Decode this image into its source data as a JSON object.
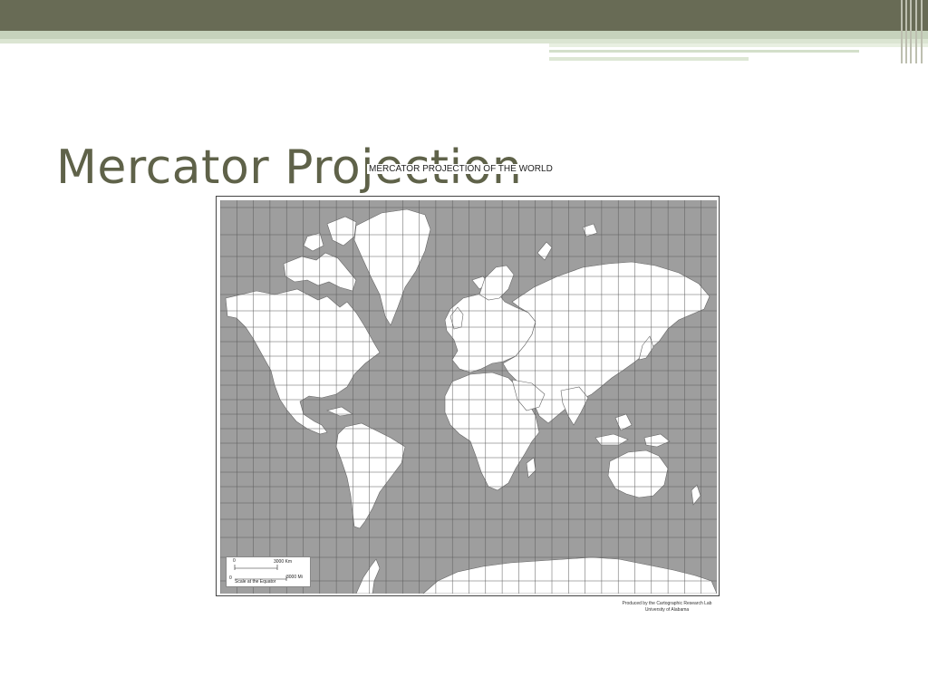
{
  "slide": {
    "title": "Mercator Projection"
  },
  "map": {
    "heading": "MERCATOR PROJECTION OF THE WORLD",
    "scale": {
      "km_label": "3000 Km",
      "mi_label": "3000 Mi",
      "zero_top": "0",
      "zero_bottom": "0",
      "caption": "Scale at the Equator"
    },
    "credit_line_1": "Produced by the Cartographic Research Lab",
    "credit_line_2": "University of Alabama",
    "colors": {
      "ocean": "#9e9e9e",
      "land": "#ffffff",
      "grid": "#5a5a5a"
    }
  }
}
